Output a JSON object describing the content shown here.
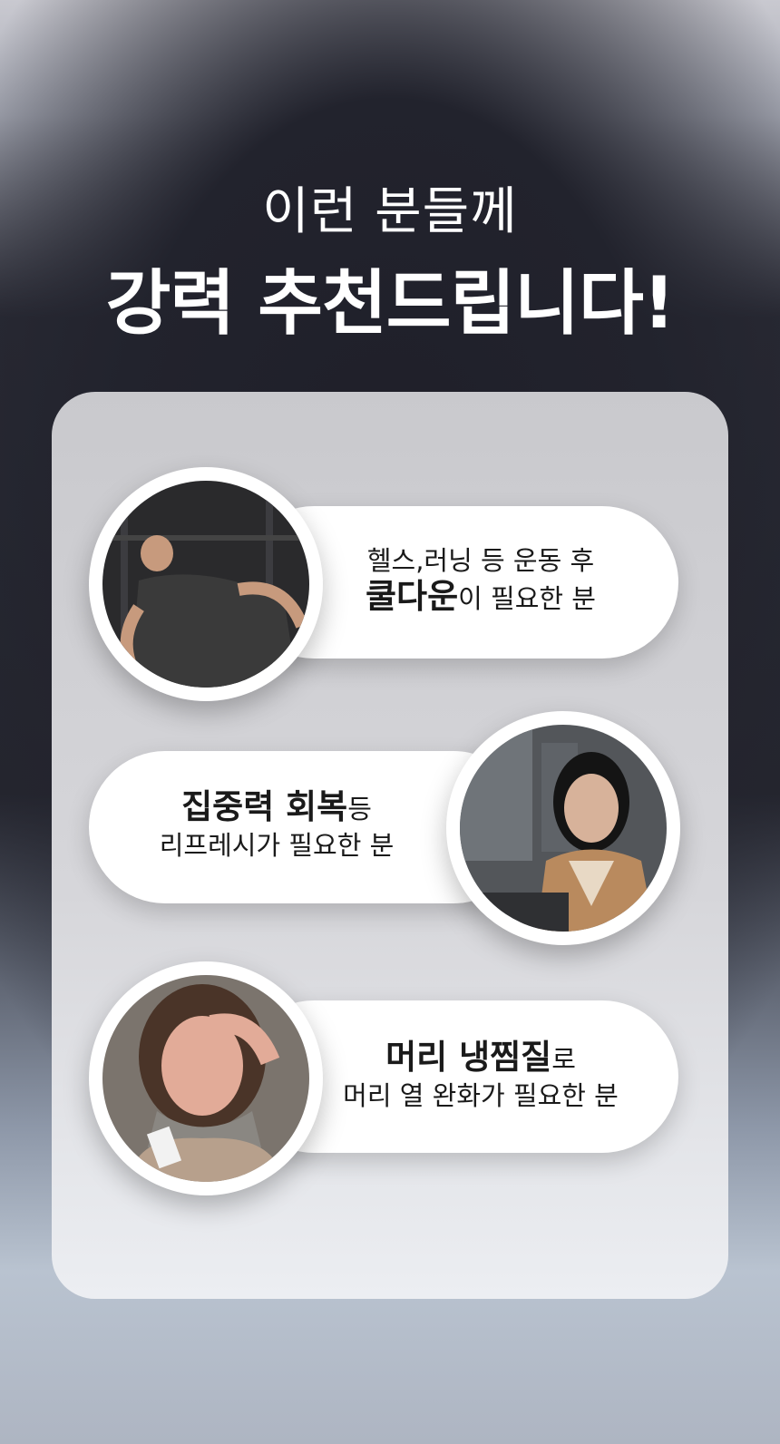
{
  "header": {
    "subtitle": "이런 분들께",
    "title": "강력 추천드립니다!"
  },
  "items": [
    {
      "image_icon": "man-exhausted-gym-photo",
      "line1": "헬스,러닝 등 운동 후",
      "line2_bold": "쿨다운",
      "line2_rest": "이 필요한 분"
    },
    {
      "image_icon": "woman-headache-office-photo",
      "line1_bold": "집중력 회복",
      "line1_rest": "등",
      "line2": "리프레시가 필요한 분"
    },
    {
      "image_icon": "woman-fever-scarf-photo",
      "line1_bold": "머리 냉찜질",
      "line1_rest": "로",
      "line2": "머리 열 완화가 필요한 분"
    }
  ]
}
